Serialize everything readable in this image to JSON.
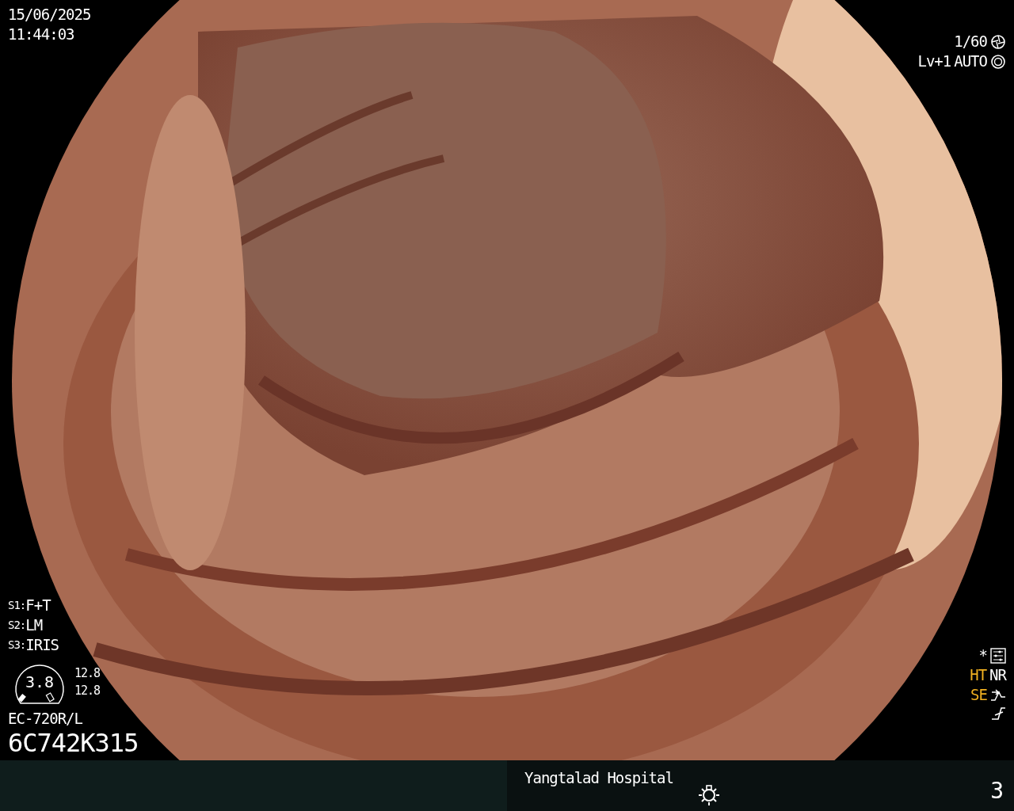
{
  "date": "15/06/2025",
  "time": "11:44:03",
  "shutter": "1/60",
  "level": "Lv+1",
  "iris_mode": "AUTO",
  "switches": [
    {
      "key": "S1:",
      "value": "F+T"
    },
    {
      "key": "S2:",
      "value": "LM"
    },
    {
      "key": "S3:",
      "value": "IRIS"
    }
  ],
  "gauge": {
    "value": "3.8",
    "readings": [
      "12.8",
      "12.8"
    ]
  },
  "scope_model": "EC-720R/L",
  "scope_serial": "6C742K315",
  "marker": "*",
  "enhancements": [
    {
      "label": "HT",
      "on": true
    },
    {
      "label": "NR",
      "on": false
    },
    {
      "label": "SE",
      "on": true
    }
  ],
  "footer": {
    "hospital": "Yangtalad Hospital",
    "page": "3"
  }
}
